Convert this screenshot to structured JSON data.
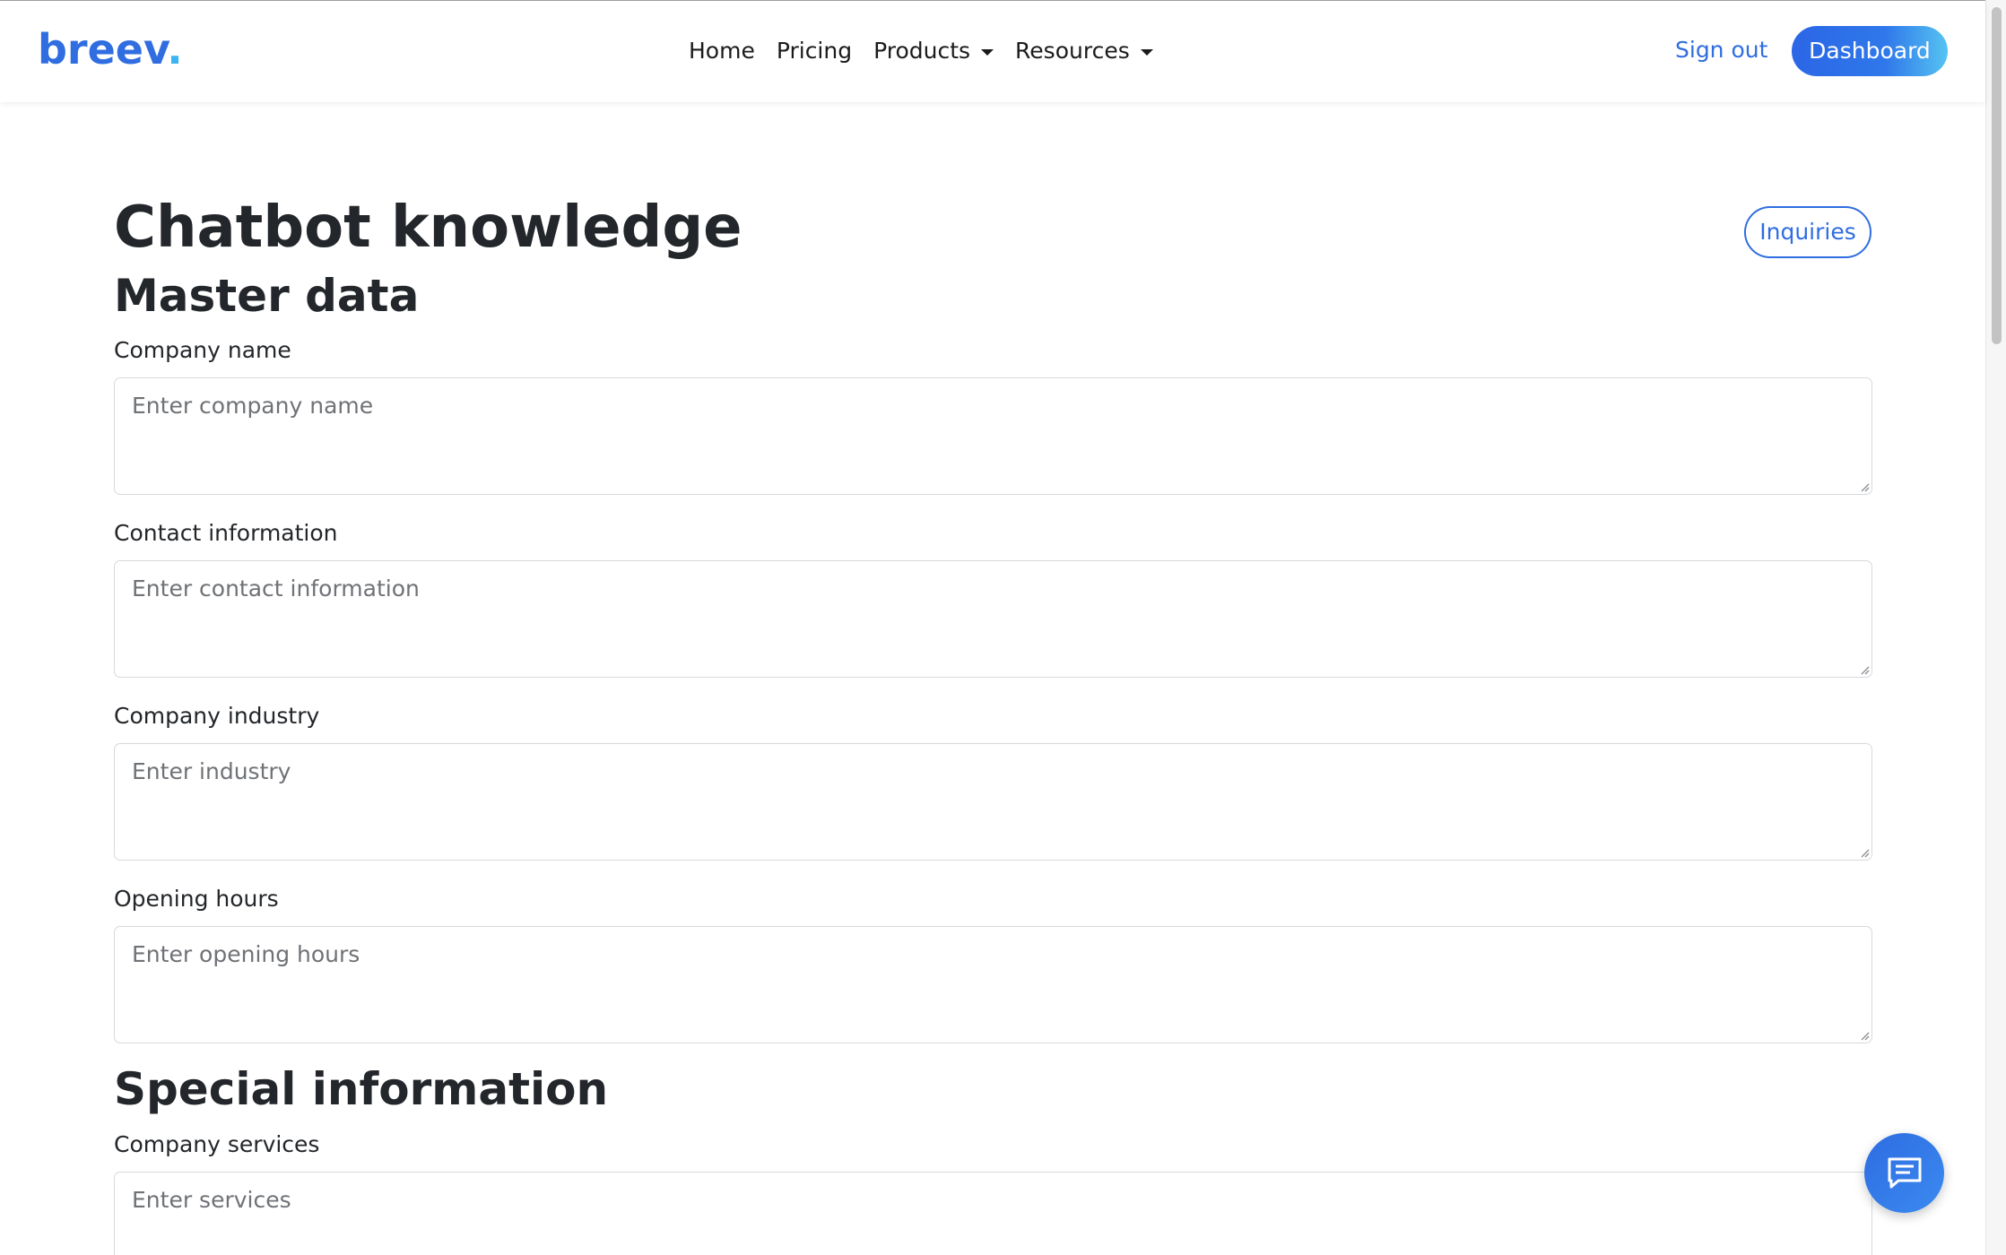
{
  "navbar": {
    "brand_main": "breev",
    "brand_dot": ".",
    "links": [
      {
        "label": "Home"
      },
      {
        "label": "Pricing"
      },
      {
        "label": "Products"
      },
      {
        "label": "Resources"
      }
    ],
    "signout_label": "Sign out",
    "dashboard_label": "Dashboard"
  },
  "header": {
    "title": "Chatbot knowledge",
    "inquiries_label": "Inquiries"
  },
  "sections": {
    "master": {
      "title": "Master data",
      "fields": [
        {
          "label": "Company name",
          "placeholder": "Enter company name"
        },
        {
          "label": "Contact information",
          "placeholder": "Enter contact information"
        },
        {
          "label": "Company industry",
          "placeholder": "Enter industry"
        },
        {
          "label": "Opening hours",
          "placeholder": "Enter opening hours"
        }
      ]
    },
    "special": {
      "title": "Special information",
      "fields": [
        {
          "label": "Company services",
          "placeholder": "Enter services"
        }
      ]
    }
  },
  "icons": {
    "chat": "chat-bubble-icon",
    "caret": "caret-down-icon",
    "resize": "resize-handle-icon"
  },
  "colors": {
    "brand": "#2f6de0",
    "brand_dot": "#3cb4f0",
    "text": "#23262a",
    "input_border": "#d6d9dd"
  }
}
